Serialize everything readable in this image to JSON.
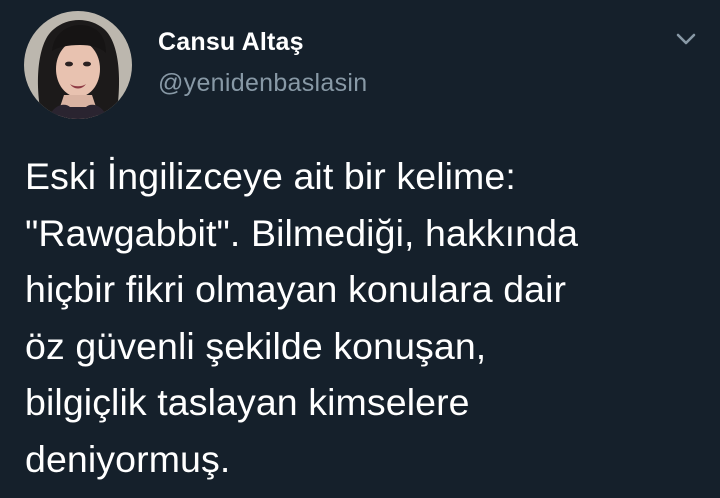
{
  "user": {
    "display_name": "Cansu Altaş",
    "handle": "@yenidenbaslasin",
    "avatar_icon": "profile-photo"
  },
  "menu": {
    "icon": "chevron-down-icon"
  },
  "tweet": {
    "lines": [
      "Eski İngilizceye ait bir kelime:",
      "\"Rawgabbit\". Bilmediği, hakkında",
      "hiçbir fikri olmayan konulara dair",
      "öz güvenli şekilde konuşan,",
      "bilgiçlik taslayan kimselere",
      "deniyormuş."
    ]
  },
  "colors": {
    "background": "#15202b",
    "primary_text": "#ffffff",
    "secondary_text": "#8899a6"
  }
}
